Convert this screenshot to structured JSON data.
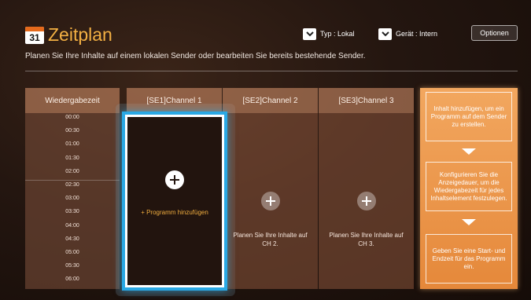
{
  "header": {
    "calendar_day": "31",
    "title": "Zeitplan",
    "subtitle": "Planen Sie Ihre Inhalte auf einem lokalen Sender oder bearbeiten Sie bereits bestehende Sender.",
    "type_dropdown": "Typ : Lokal",
    "device_dropdown": "Gerät : Intern",
    "options_button": "Optionen"
  },
  "time_column": {
    "header": "Wiedergabezeit",
    "times": [
      "00:00",
      "00:30",
      "01:00",
      "01:30",
      "02:00",
      "02:30",
      "03:00",
      "03:30",
      "04:00",
      "04:30",
      "05:00",
      "05:30",
      "06:00"
    ]
  },
  "channels": [
    {
      "header": "[SE1]Channel 1",
      "text": "+ Programm hinzufügen",
      "selected": true
    },
    {
      "header": "[SE2]Channel 2",
      "text": "Planen Sie Ihre Inhalte auf CH 2.",
      "selected": false
    },
    {
      "header": "[SE3]Channel 3",
      "text": "Planen Sie Ihre Inhalte auf CH 3.",
      "selected": false
    }
  ],
  "help": {
    "step1": "Inhalt hinzufügen, um ein Programm auf dem Sender zu erstellen.",
    "step2": "Konfigurieren Sie die Anzeigedauer, um die Wiedergabezeit für jedes Inhaltselement festzulegen.",
    "step3": "Geben Sie eine Start- und Endzeit für das Programm ein."
  },
  "colors": {
    "accent_orange": "#f3b043",
    "focus_blue": "#2aa8e4",
    "help_panel": "#e5883a"
  }
}
